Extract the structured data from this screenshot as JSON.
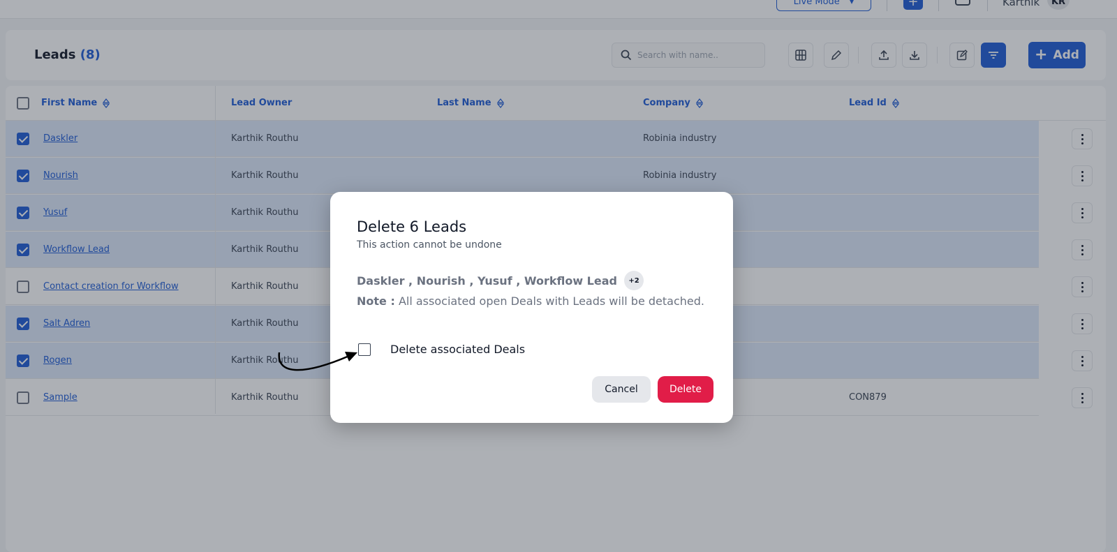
{
  "topbar": {
    "live_mode_label": "Live Mode",
    "user_name": "Karthik",
    "avatar_initials": "KR"
  },
  "header": {
    "title": "Leads",
    "count": "(8)",
    "search_placeholder": "Search with name..",
    "add_label": "Add"
  },
  "table": {
    "columns": [
      "First Name",
      "Lead Owner",
      "Last Name",
      "Company",
      "Lead Id"
    ],
    "rows": [
      {
        "first_name": "Daskler",
        "owner": "Karthik Routhu",
        "last_name": "",
        "company": "Robinia industry",
        "lead_id": "",
        "selected": true
      },
      {
        "first_name": "Nourish",
        "owner": "Karthik Routhu",
        "last_name": "",
        "company": "Robinia industry",
        "lead_id": "",
        "selected": true
      },
      {
        "first_name": "Yusuf",
        "owner": "Karthik Routhu",
        "last_name": "",
        "company": "",
        "lead_id": "",
        "selected": true
      },
      {
        "first_name": "Workflow Lead",
        "owner": "Karthik Routhu",
        "last_name": "",
        "company": "",
        "lead_id": "",
        "selected": true
      },
      {
        "first_name": "Contact creation for Workflow",
        "owner": "Karthik Routhu",
        "last_name": "",
        "company": "",
        "lead_id": "",
        "selected": false
      },
      {
        "first_name": "Salt Adren",
        "owner": "Karthik Routhu",
        "last_name": "",
        "company": "",
        "lead_id": "",
        "selected": true
      },
      {
        "first_name": "Rogen",
        "owner": "Karthik Routhu",
        "last_name": "",
        "company": "",
        "lead_id": "",
        "selected": true
      },
      {
        "first_name": "Sample",
        "owner": "Karthik Routhu",
        "last_name": "",
        "company": "",
        "lead_id": "CON879",
        "selected": false
      }
    ]
  },
  "modal": {
    "title": "Delete 6 Leads",
    "subtitle": "This action cannot be undone",
    "names": "Daskler , Nourish , Yusuf , Workflow Lead",
    "more_badge": "+2",
    "note_label": "Note :",
    "note_text": "All associated open Deals with Leads will be detached.",
    "checkbox_label": "Delete associated Deals",
    "cancel_label": "Cancel",
    "delete_label": "Delete"
  },
  "colors": {
    "primary": "#1d5bd6",
    "danger": "#e11d48",
    "selected_row": "#dde8fb"
  }
}
